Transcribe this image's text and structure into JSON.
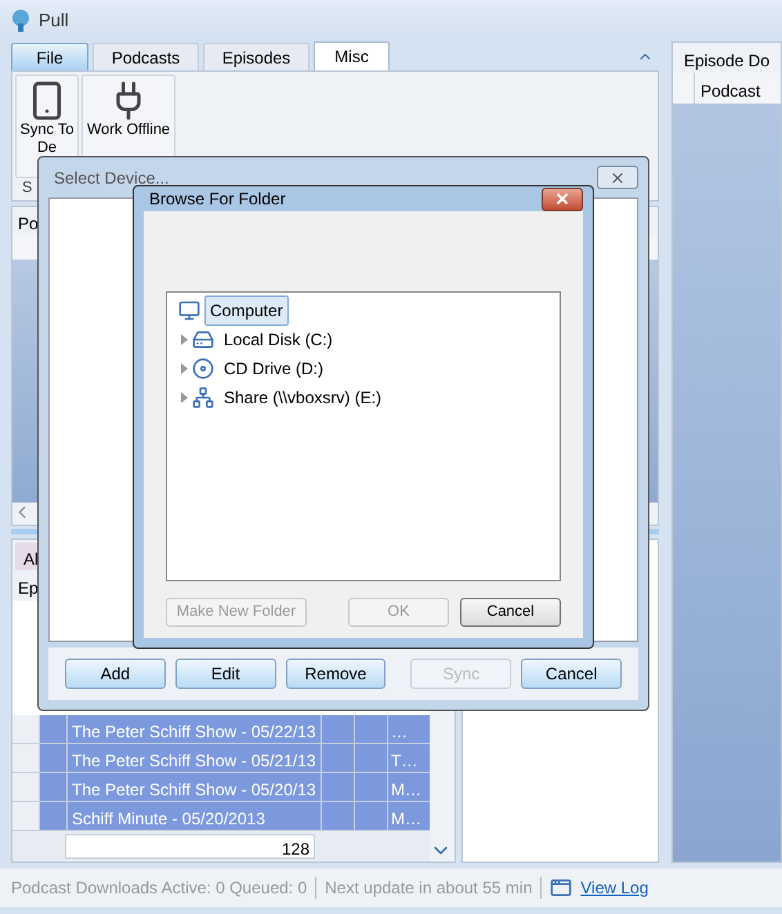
{
  "window": {
    "title": "Pull"
  },
  "ribbon": {
    "tabs": [
      {
        "label": "File",
        "selected": false
      },
      {
        "label": "Podcasts",
        "selected": false
      },
      {
        "label": "Episodes",
        "selected": false
      },
      {
        "label": "Misc",
        "selected": true
      }
    ],
    "buttons": [
      {
        "label": "Sync To De",
        "kind": "phone"
      },
      {
        "label": "Work Offline",
        "kind": "plug"
      }
    ],
    "group_label": "S"
  },
  "left_panels": {
    "podcasts_header": "Po",
    "filter_tab": "Al",
    "episodes_header": "Ep"
  },
  "episodes": {
    "rows": [
      {
        "title": "The Peter Schiff Show - 05/22/13",
        "column_5": "…",
        "selected": true
      },
      {
        "title": "The Peter Schiff Show - 05/21/13",
        "column_5": "T…",
        "selected": true
      },
      {
        "title": "The Peter Schiff Show - 05/20/13",
        "column_5": "M…",
        "selected": true
      },
      {
        "title": "Schiff Minute - 05/20/2013",
        "column_5": "M…",
        "selected": true
      }
    ],
    "footer_count": "128"
  },
  "right_panel": {
    "title": "Episode Do",
    "column": "Podcast"
  },
  "status_bar": {
    "downloads": "Podcast Downloads Active: 0 Queued: 0",
    "next_update": "Next update in about 55 min",
    "link": "View Log"
  },
  "select_device": {
    "title": "Select Device...",
    "buttons": [
      {
        "label": "Add",
        "disabled": false
      },
      {
        "label": "Edit",
        "disabled": false
      },
      {
        "label": "Remove",
        "disabled": false
      },
      {
        "label": "Sync",
        "disabled": true
      },
      {
        "label": "Cancel",
        "disabled": false
      }
    ]
  },
  "browse_folder": {
    "title": "Browse For Folder",
    "tree": [
      {
        "label": "Computer",
        "kind": "computer",
        "selected": true,
        "children": [
          {
            "label": "Local Disk (C:)",
            "kind": "disk",
            "selected": false,
            "expanded": false
          },
          {
            "label": "CD Drive (D:)",
            "kind": "cd",
            "selected": false,
            "expanded": false
          },
          {
            "label": "Share (\\\\vboxsrv) (E:)",
            "kind": "share",
            "selected": false,
            "expanded": false
          }
        ]
      }
    ],
    "buttons": [
      {
        "label": "Make New Folder",
        "disabled": true
      },
      {
        "label": "OK",
        "disabled": true
      },
      {
        "label": "Cancel",
        "disabled": false
      }
    ]
  }
}
